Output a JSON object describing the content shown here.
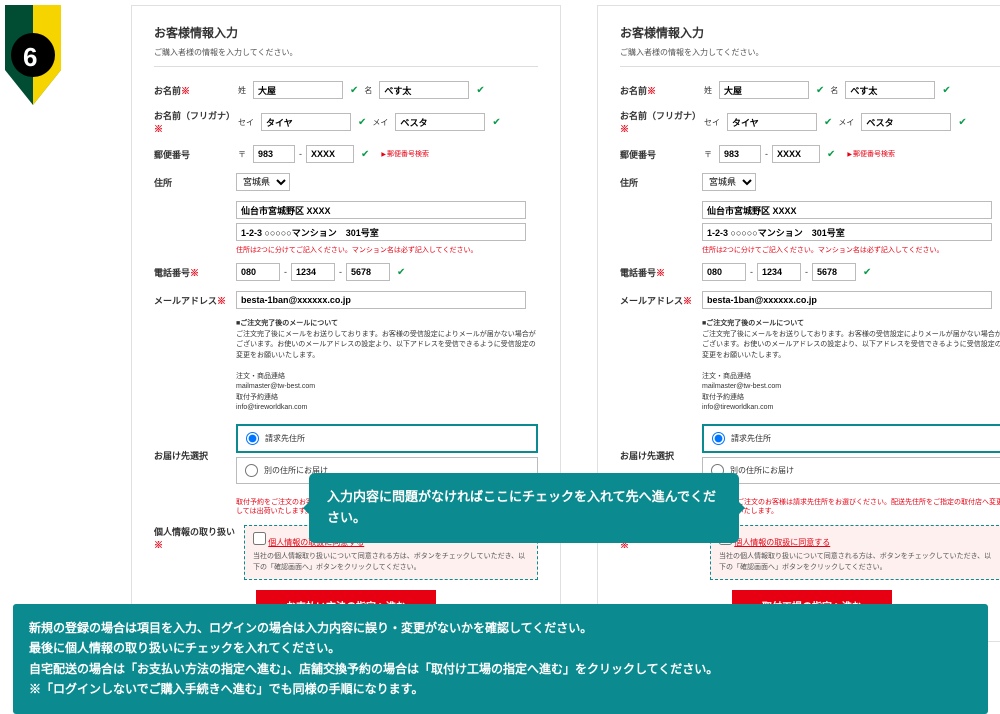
{
  "badge": {
    "number": "6"
  },
  "card": {
    "title": "お客様情報入力",
    "subtitle": "ご購入者様の情報を入力してください。",
    "labels": {
      "name": "お名前",
      "kana": "お名前（フリガナ）",
      "zip": "郵便番号",
      "addr": "住所",
      "tel": "電話番号",
      "email": "メールアドレス",
      "deliv": "お届け先選択",
      "consent": "個人情報の取り扱い"
    },
    "sub": {
      "sei": "姓",
      "mei": "名",
      "seiK": "セイ",
      "meiK": "メイ",
      "zip": "〒"
    },
    "vals": {
      "sei": "大屋",
      "mei": "べす太",
      "seiK": "タイヤ",
      "meiK": "ベスタ",
      "zip1": "983",
      "zip2": "XXXX",
      "pref": "宮城県",
      "addr1": "仙台市宮城野区 XXXX",
      "addr2": "1-2-3 ○○○○○マンション　301号室",
      "tel1": "080",
      "tel2": "1234",
      "tel3": "5678",
      "email": "besta-1ban@xxxxxx.co.jp"
    },
    "zipLink": "郵便番号検索",
    "addrNote": "住所は2つに分けてご記入ください。マンション名は必ず記入してください。",
    "emailNote": {
      "t1": "■ご注文完了後のメールについて",
      "t2": "ご注文完了後にメールをお送りしております。お客様の受信設定によりメールが届かない場合がございます。お使いのメールアドレスの設定より、以下アドレスを受信できるように受信設定の変更をお願いいたします。",
      "t3": "注文・商品連絡",
      "t4": "mailmaster@tw-best.com",
      "t5": "取付予約連絡",
      "t6": "info@tireworldkan.com"
    },
    "deliv": {
      "opt1": "請求先住所",
      "opt2": "別の住所にお届け"
    },
    "delivNote": "取付予約をご注文のお客様は請求先住所をお選びください。配送先住所をご指定の取付店へ変更しては出荷いたします。",
    "consent": {
      "chk": "個人情報の取扱に同意する",
      "sub": "当社の個人情報取り扱いについて同意される方は、ボタンをチェックしていただき、以下の「確認画面へ」ボタンをクリックしてください。"
    },
    "submit": {
      "pay": "お支払い方法の指定へ進む",
      "shop": "取付工場の指定へ進む"
    }
  },
  "tooltip": "入力内容に問題がなければここにチェックを入れて先へ進んでください。",
  "bottom": {
    "l1": "新規の登録の場合は項目を入力、ログインの場合は入力内容に誤り・変更がないかを確認してください。",
    "l2": "最後に個人情報の取り扱いにチェックを入れてください。",
    "l3": "自宅配送の場合は「お支払い方法の指定へ進む」、店舗交換予約の場合は「取付け工場の指定へ進む」をクリックしてください。",
    "l4": "※「ログインしないでご購入手続きへ進む」でも同様の手順になります。"
  }
}
